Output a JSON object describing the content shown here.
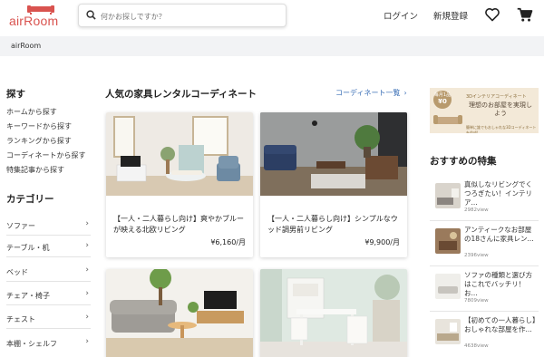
{
  "header": {
    "logo_text": "airRoom",
    "search_placeholder": "何かお探しですか？",
    "login_label": "ログイン",
    "signup_label": "新規登録"
  },
  "breadcrumb": {
    "current": "airRoom"
  },
  "sidebar": {
    "search_heading": "探す",
    "search_links": [
      "ホームから探す",
      "キーワードから探す",
      "ランキングから探す",
      "コーディネートから探す",
      "特集記事から探す"
    ],
    "category_heading": "カテゴリー",
    "categories": [
      "ソファー",
      "テーブル・机",
      "ベッド",
      "チェア・椅子",
      "チェスト",
      "本棚・シェルフ"
    ]
  },
  "main": {
    "title": "人気の家具レンタルコーディネート",
    "more_link": "コーディネート一覧",
    "cards": [
      {
        "title": "【一人・二人暮らし向け】爽やかブルーが映える北欧リビング",
        "price": "¥6,160/月"
      },
      {
        "title": "【一人・二人暮らし向け】シンプルなウッド調男前リビング",
        "price": "¥9,900/月"
      },
      {
        "title": "",
        "price": ""
      },
      {
        "title": "",
        "price": ""
      }
    ]
  },
  "banner": {
    "badge_line1": "毎月1品",
    "badge_line2": "¥0",
    "subtitle": "3Dインテリアコーディネート",
    "headline": "理想のお部屋を実現しよう",
    "footnote": "簡単に誰でもおしゃれな3Dコーディネートを作成!"
  },
  "recommended": {
    "heading": "おすすめの特集",
    "items": [
      {
        "title": "真似しなリビングでくつろぎたい！インテリア...",
        "views": "2982view"
      },
      {
        "title": "アンティークなお部屋の18さんに家具レン...",
        "views": "2396view"
      },
      {
        "title": "ソファの種類と選び方はこれでバッチリ！ お...",
        "views": "7809view"
      },
      {
        "title": "【初めての一人暮らし】おしゃれな部屋を作...",
        "views": "4638view"
      }
    ]
  },
  "colors": {
    "brand": "#d9534f",
    "link": "#3b6fb6",
    "crumb_bg": "#f2f3f5"
  }
}
